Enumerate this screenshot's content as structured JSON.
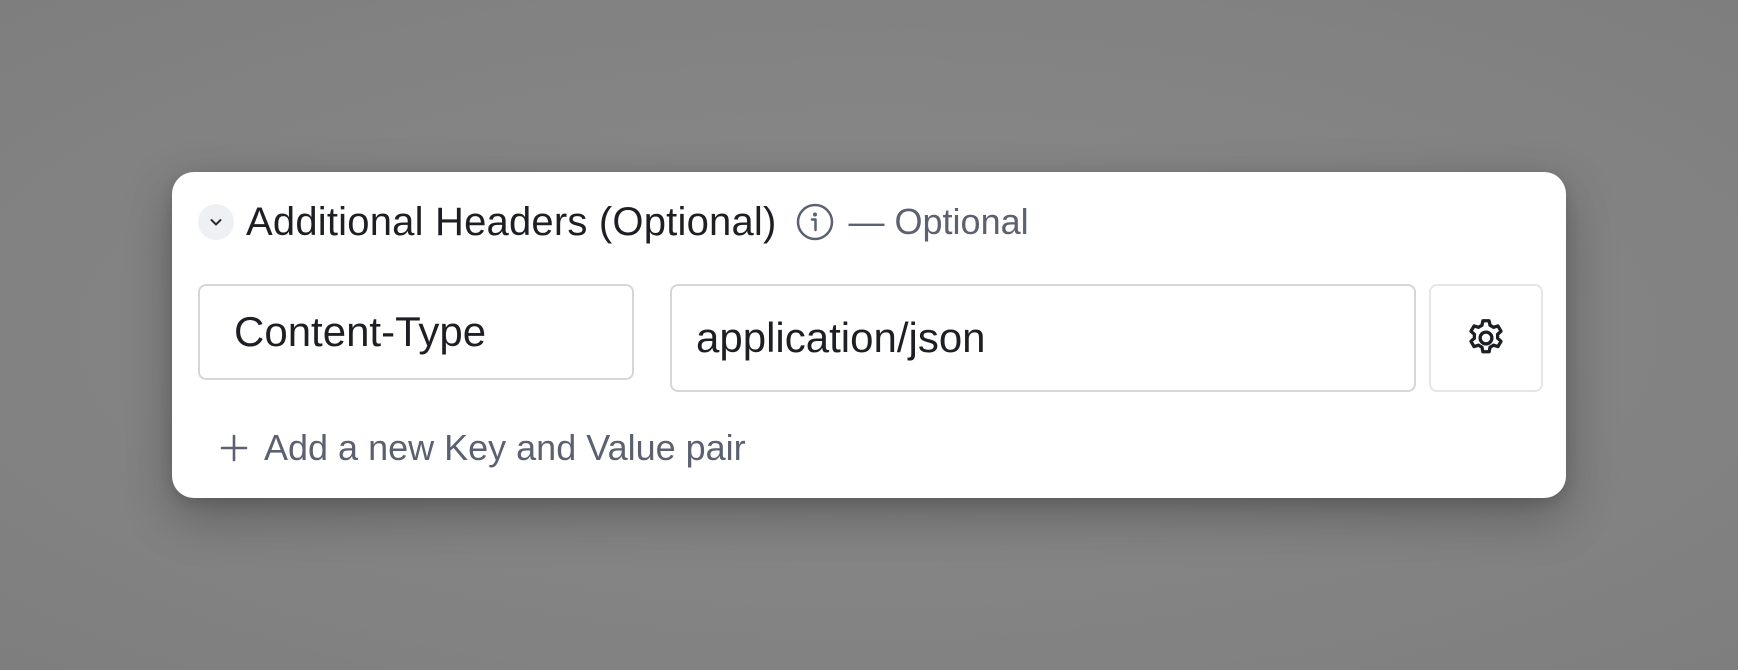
{
  "headers_section": {
    "title": "Additional Headers (Optional)",
    "optional_note": "— Optional",
    "collapse_icon": "chevron-down-icon",
    "info_icon": "info-icon"
  },
  "header_pair": {
    "key_value": "Content-Type",
    "value_value": "application/json",
    "settings_icon": "gear-icon"
  },
  "add_pair": {
    "label": "Add a new Key and Value pair",
    "icon": "plus-icon"
  },
  "colors": {
    "backdrop": "#868686",
    "card": "#ffffff",
    "text_primary": "#1d1f24",
    "text_secondary": "#5b6170",
    "border": "#d4d6da"
  }
}
